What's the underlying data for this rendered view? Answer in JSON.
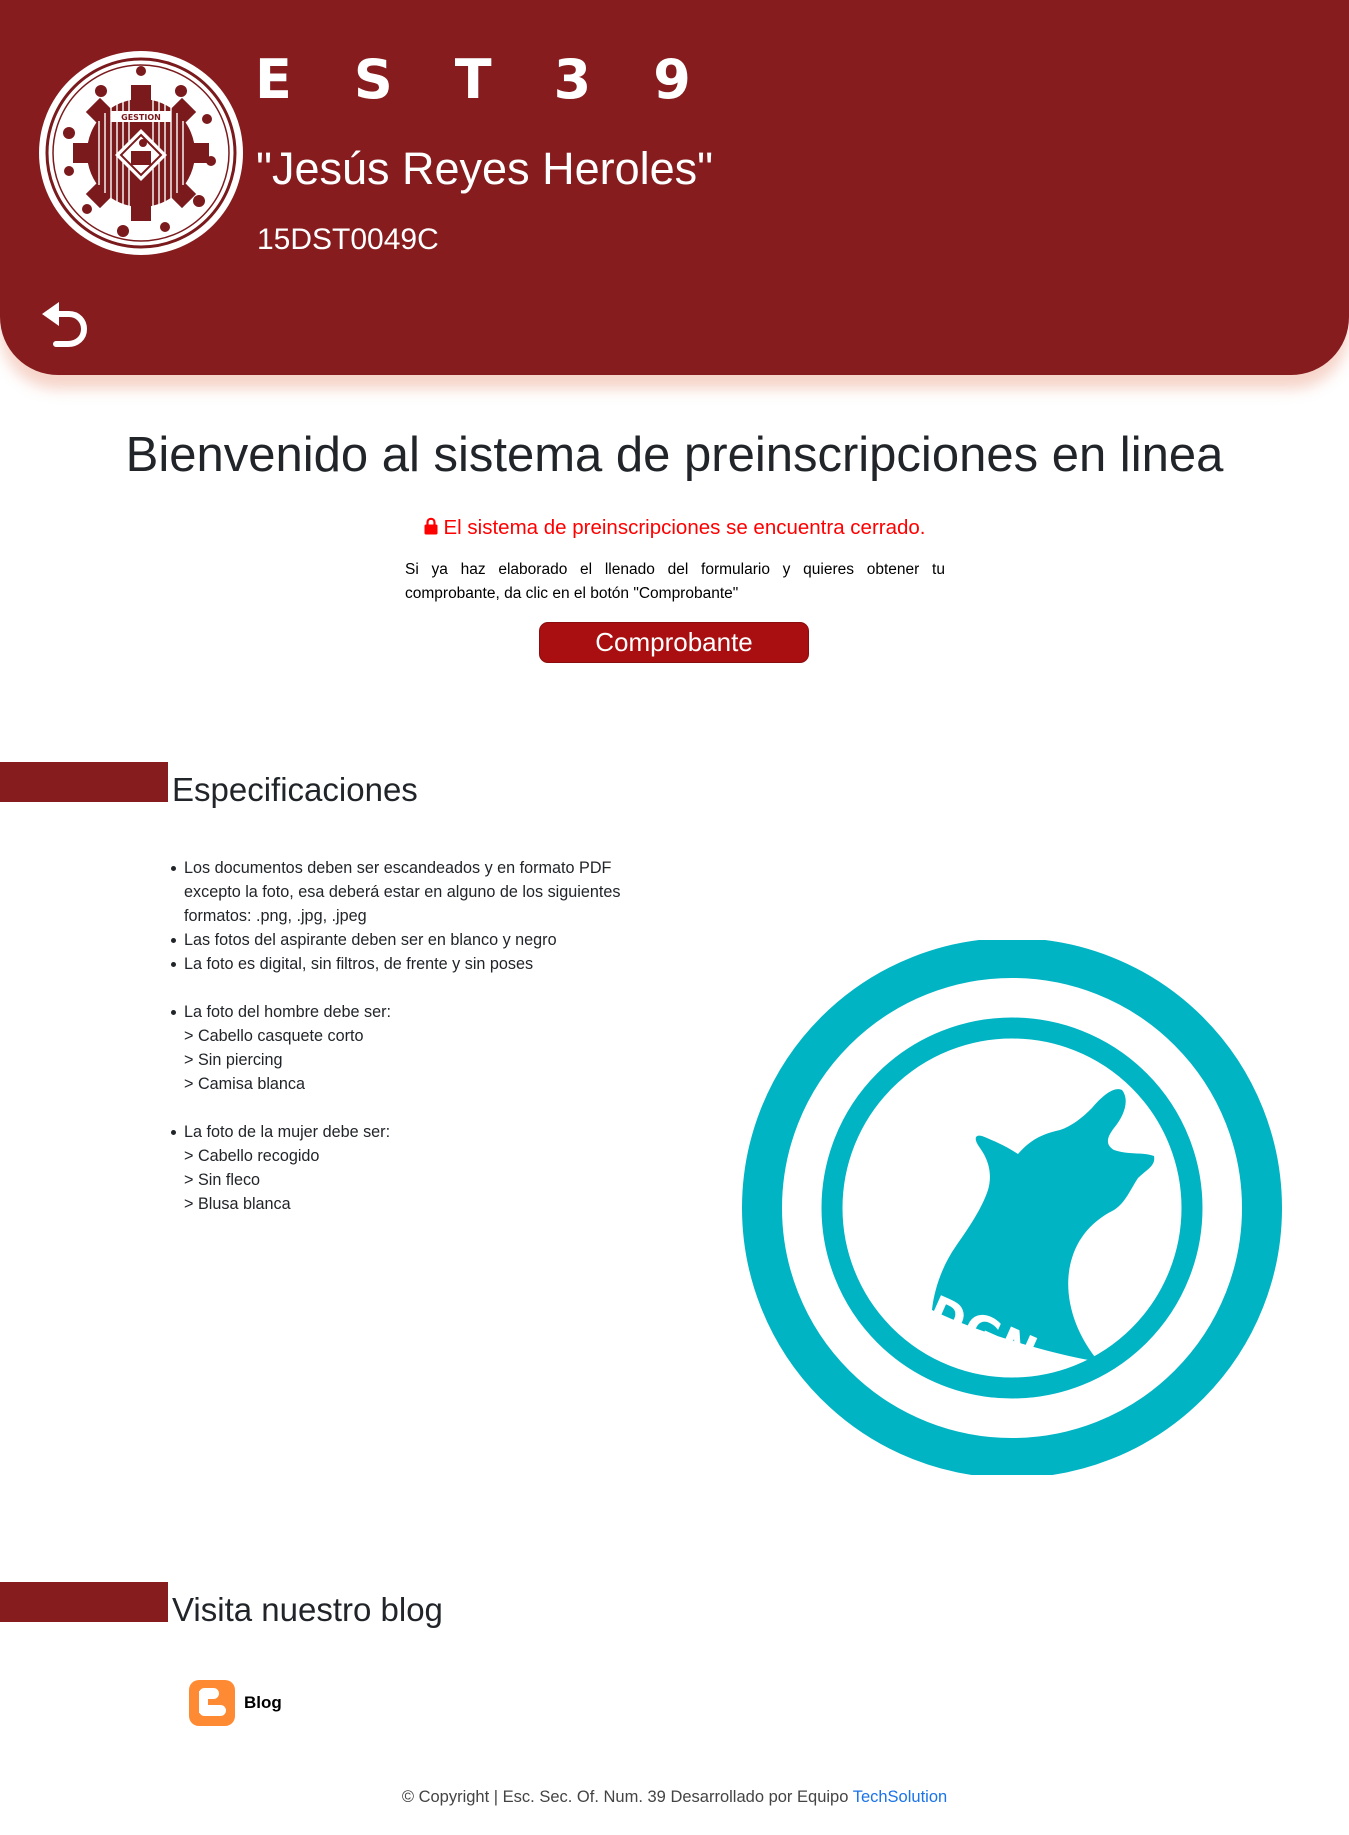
{
  "header": {
    "abbr": "EST39",
    "name": "\"Jesús Reyes Heroles\"",
    "code": "15DST0049C",
    "logo_text": "GESTION",
    "logo_icon": "school-seal-gear-icon",
    "back_icon": "undo-arrow-icon",
    "bg_color": "#861c1e"
  },
  "main": {
    "title": "Bienvenido al sistema de preinscripciones en linea",
    "closed_notice": "El sistema de preinscripciones se encuentra cerrado.",
    "closed_icon": "lock-icon",
    "closed_color": "#ff0000",
    "info_text": "Si ya haz elaborado el llenado del formulario y quieres obtener tu comprobante, da clic en el botón \"Comprobante\"",
    "button_label": "Comprobante",
    "button_color": "#a90f10"
  },
  "specs": {
    "title": "Especificaciones",
    "items": [
      {
        "lines": [
          "Los documentos deben ser escandeados y en formato PDF excepto la foto, esa deberá estar en alguno de los siguientes formatos: .png, .jpg, .jpeg"
        ]
      },
      {
        "lines": [
          "Las fotos del aspirante deben ser en blanco y negro"
        ]
      },
      {
        "lines": [
          "La foto es digital, sin filtros, de frente y sin poses"
        ]
      },
      {
        "lines": [
          "La foto del hombre debe ser:",
          "> Cabello casquete corto",
          "> Sin piercing",
          "> Camisa blanca"
        ]
      },
      {
        "lines": [
          "La foto de la mujer debe ser:",
          "> Cabello recogido",
          "> Sin fleco",
          "> Blusa blanca"
        ]
      }
    ],
    "logo_text": "PDGN",
    "logo_icon": "howling-wolf-icon",
    "logo_color": "#00b4c4"
  },
  "blog": {
    "title": "Visita nuestro blog",
    "label": "Blog",
    "icon": "blogger-icon",
    "icon_color": "#ff8a34"
  },
  "footer": {
    "text": "© Copyright | Esc. Sec. Of. Num. 39 Desarrollado por Equipo",
    "link": "TechSolution",
    "link_color": "#1a73e8"
  }
}
